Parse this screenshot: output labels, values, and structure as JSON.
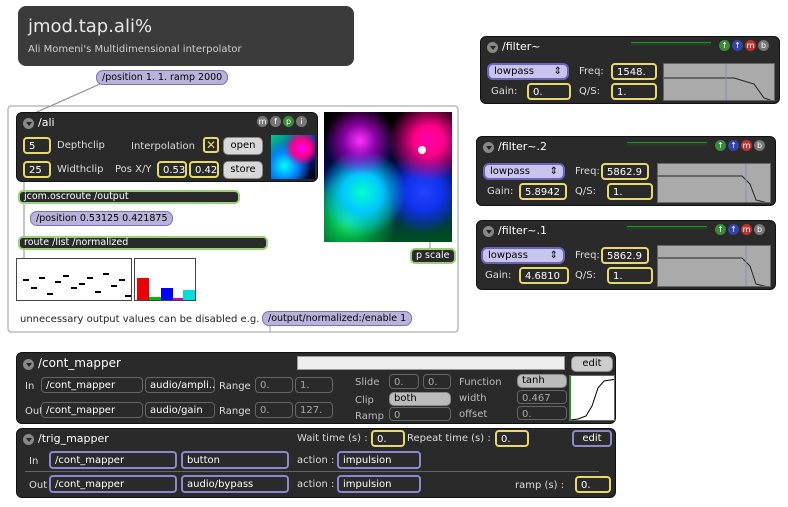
{
  "title": {
    "name": "jmod.tap.ali%",
    "subtitle": "Ali Momeni's Multidimensional interpolator"
  },
  "messages": {
    "position_msg": "/position 1. 1. ramp 2000",
    "position_out": "/position 0.53125 0.421875",
    "enable_msg": "/output/normalized:/enable 1"
  },
  "ali": {
    "name": "/ali",
    "depthclip_value": "5",
    "depthclip_label": "Depthclip",
    "widthclip_value": "25",
    "widthclip_label": "Widthclip",
    "interpolation_label": "Interpolation",
    "open_label": "open",
    "store_label": "store",
    "posxy_label": "Pos X/Y",
    "pos_x": "0.53",
    "pos_y": "0.42",
    "icon_letters": [
      "m",
      "f",
      "p",
      "i"
    ]
  },
  "objects": {
    "oscroute": "jcom.oscroute /output",
    "route": "route /list /normalized",
    "pscale": "p scale"
  },
  "note": "unnecessary output values can be disabled e.g.",
  "filters": [
    {
      "name": "/filter~",
      "type": "lowpass",
      "freq_label": "Freq:",
      "freq": "1548.",
      "gain_label": "Gain:",
      "gain": "0.",
      "qs_label": "Q/S:",
      "qs": "1."
    },
    {
      "name": "/filter~.2",
      "type": "lowpass",
      "freq_label": "Freq:",
      "freq": "5862.9",
      "gain_label": "Gain:",
      "gain": "5.8942",
      "qs_label": "Q/S:",
      "qs": "1."
    },
    {
      "name": "/filter~.1",
      "type": "lowpass",
      "freq_label": "Freq:",
      "freq": "5862.9",
      "gain_label": "Gain:",
      "gain": "4.6810",
      "qs_label": "Q/S:",
      "qs": "1."
    }
  ],
  "filter_icons": [
    "",
    "",
    "m",
    "b"
  ],
  "cont_mapper": {
    "name": "/cont_mapper",
    "edit_label": "edit",
    "in_label": "In",
    "in_module": "/cont_mapper",
    "in_param": "audio/ampli..",
    "out_label": "Out",
    "out_module": "/cont_mapper",
    "out_param": "audio/gain",
    "range_label": "Range",
    "in_range_lo": "0.",
    "in_range_hi": "1.",
    "out_range_lo": "0.",
    "out_range_hi": "127.",
    "slide_label": "Slide",
    "slide_a": "0.",
    "slide_b": "0.",
    "clip_label": "Clip",
    "clip_value": "both",
    "ramp_label": "Ramp",
    "ramp_value": "0",
    "function_label": "Function",
    "function_value": "tanh",
    "width_label": "width",
    "width_value": "0.467",
    "offset_label": "offset",
    "offset_value": "0."
  },
  "trig_mapper": {
    "name": "/trig_mapper",
    "edit_label": "edit",
    "wait_label": "Wait time (s) :",
    "wait_value": "0.",
    "repeat_label": "Repeat time (s) :",
    "repeat_value": "0.",
    "in_label": "In",
    "in_module": "/cont_mapper",
    "in_param": "button",
    "out_label": "Out",
    "out_module": "/cont_mapper",
    "out_param": "audio/bypass",
    "action_label": "action :",
    "in_action": "impulsion",
    "out_action": "impulsion",
    "ramp_label": "ramp (s) :",
    "ramp_value": "0."
  }
}
